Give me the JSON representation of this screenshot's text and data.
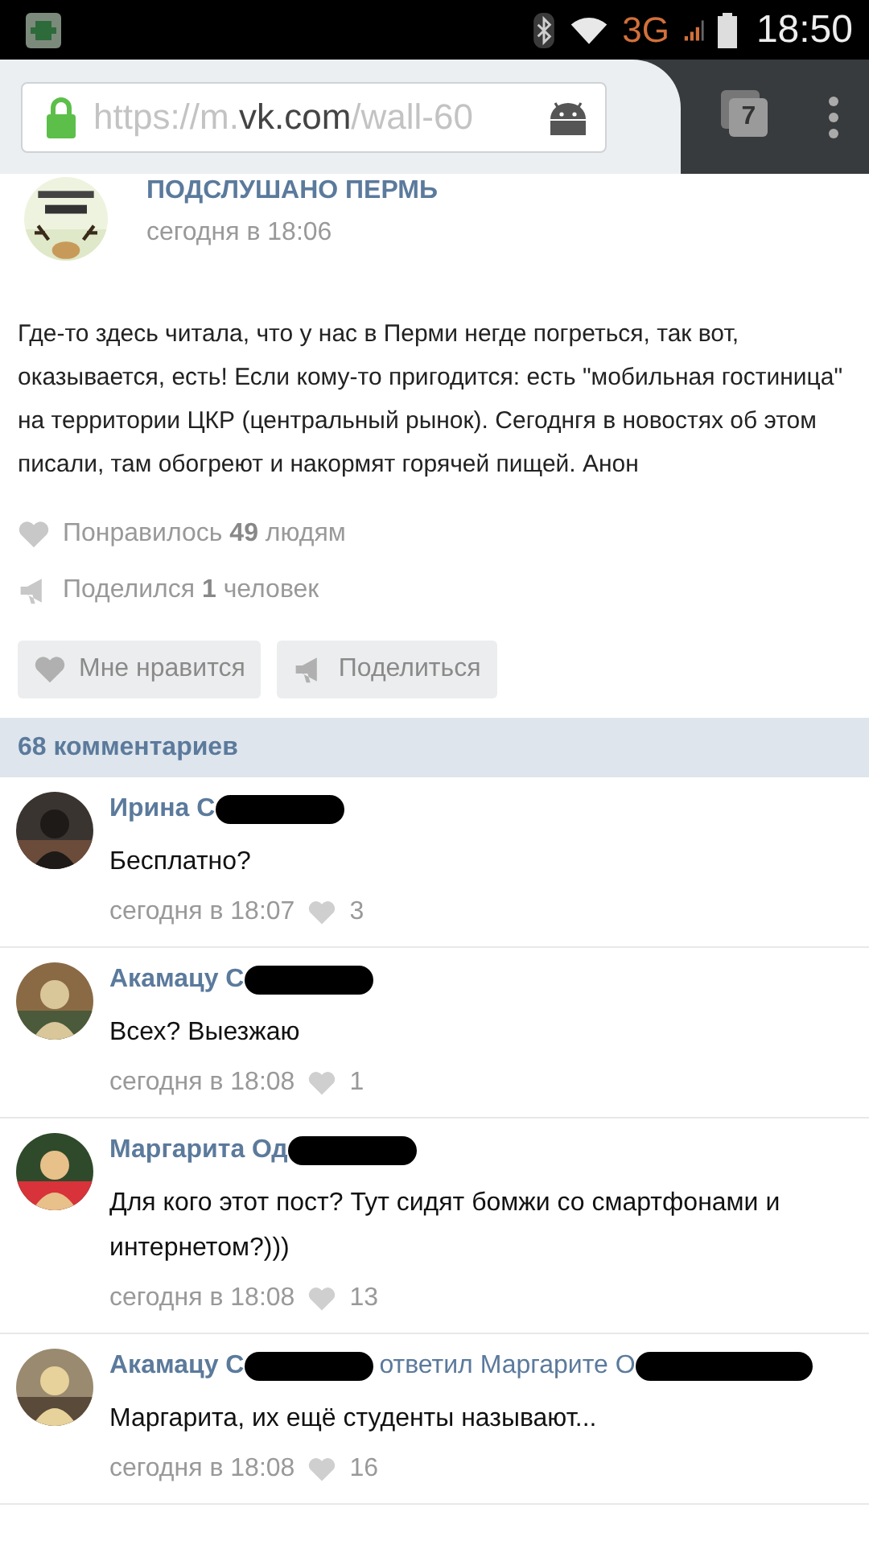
{
  "status_bar": {
    "network": "3G",
    "time": "18:50"
  },
  "browser": {
    "url": {
      "prefix": "https://m.",
      "domain": "vk.com",
      "path": "/wall-60"
    },
    "tab_count": "7"
  },
  "post": {
    "author": "ПОДСЛУШАНО ПЕРМЬ",
    "time": "сегодня в 18:06",
    "text": "Где-то здесь читала, что у нас в Перми негде погреться, так вот, оказывается, есть! Если кому-то пригодится: есть \"мобильная гостиница\" на территории ЦКР (центральный рынок). Сегоднгя в новостях об этом писали, там обогреют и накормят горячей пищей. Анон",
    "stats": [
      {
        "kind": "likes",
        "text": "Понравилось **49** людям"
      },
      {
        "kind": "shares",
        "text": "Поделился **1** человек"
      }
    ],
    "buttons": [
      {
        "kind": "like",
        "label": "Мне нравится"
      },
      {
        "kind": "share",
        "label": "Поделиться"
      }
    ]
  },
  "comments_header": "68 комментариев",
  "comments": [
    {
      "author": "Ирина С",
      "author_redacted": true,
      "text": "Бесплатно?",
      "time": "сегодня в 18:07",
      "likes": "3"
    },
    {
      "author": "Акамацу С",
      "author_redacted": true,
      "text": "Всех? Выезжаю",
      "time": "сегодня в 18:08",
      "likes": "1"
    },
    {
      "author": "Маргарита Од",
      "author_redacted": true,
      "text": "Для кого этот пост? Тут сидят бомжи со смартфонами и интернетом?)))",
      "time": "сегодня в 18:08",
      "likes": "13"
    },
    {
      "author": "Акамацу С",
      "author_redacted": true,
      "reply_to": {
        "text": "ответил Маргарите О",
        "redacted": true
      },
      "text": "Маргарита, их ещё студенты называют...",
      "time": "сегодня в 18:08",
      "likes": "16"
    }
  ]
}
